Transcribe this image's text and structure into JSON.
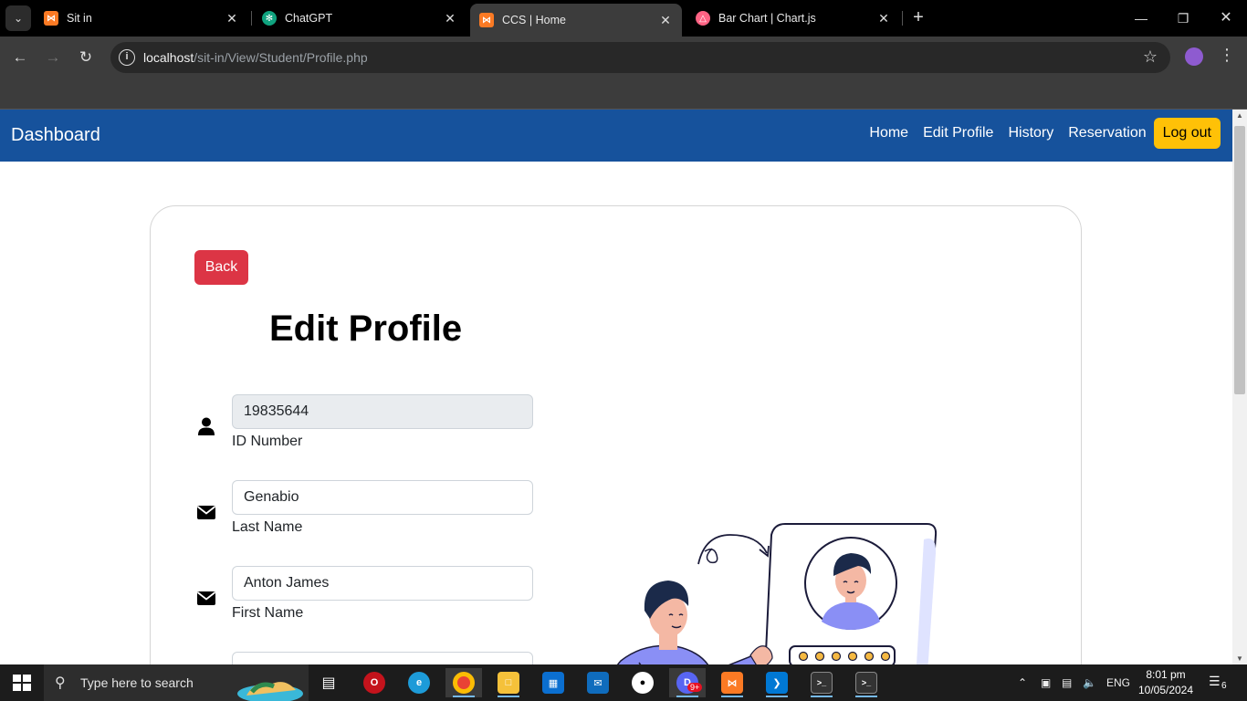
{
  "browser": {
    "tabs": [
      {
        "title": "Sit in",
        "icon": "xampp-icon",
        "active": false
      },
      {
        "title": "ChatGPT",
        "icon": "chatgpt-icon",
        "active": false
      },
      {
        "title": "CCS | Home",
        "icon": "xampp-icon",
        "active": true
      },
      {
        "title": "Bar Chart | Chart.js",
        "icon": "chartjs-icon",
        "active": false
      }
    ],
    "url_host": "localhost",
    "url_path": "/sit-in/View/Student/Profile.php"
  },
  "navbar": {
    "brand": "Dashboard",
    "links": [
      "Home",
      "Edit Profile",
      "History",
      "Reservation"
    ],
    "logout_label": "Log out"
  },
  "card": {
    "back_label": "Back",
    "heading": "Edit Profile",
    "fields": [
      {
        "value": "19835644",
        "label": "ID Number",
        "icon": "user-icon",
        "readonly": true
      },
      {
        "value": "Genabio",
        "label": "Last Name",
        "icon": "envelope-icon",
        "readonly": false
      },
      {
        "value": "Anton James",
        "label": "First Name",
        "icon": "envelope-icon",
        "readonly": false
      },
      {
        "value": "",
        "label": "",
        "icon": "envelope-icon",
        "readonly": false
      }
    ]
  },
  "taskbar": {
    "search_placeholder": "Type here to search",
    "language": "ENG",
    "time": "8:01 pm",
    "date": "10/05/2024",
    "notifications": "6",
    "badge": "9+"
  },
  "colors": {
    "navbar": "#16529c",
    "logout": "#ffc107",
    "back": "#dc3545"
  }
}
